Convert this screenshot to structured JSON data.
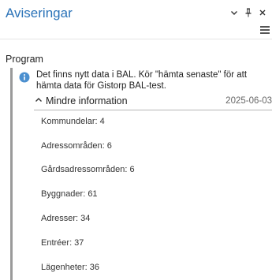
{
  "header": {
    "title": "Aviseringar"
  },
  "icons": {
    "options": "chevron-down-icon",
    "pin": "pin-icon",
    "close": "close-icon",
    "menu": "hamburger-menu-icon",
    "info": "info-icon",
    "toggle": "chevron-up-icon"
  },
  "colors": {
    "title": "#2b73b8",
    "info_icon": "#4b8fcf",
    "message_bar": "#9a9a9a"
  },
  "section": {
    "heading": "Program"
  },
  "notification": {
    "text": "Det finns nytt data i BAL. Kör \"hämta senaste\" för att hämta data för Gistorp BAL-test.",
    "toggle_label": "Mindre information",
    "date": "2025-06-03",
    "details": [
      "Kommundelar: 4",
      "Adressområden: 6",
      "Gårdsadressområden: 6",
      "Byggnader: 61",
      "Adresser: 34",
      "Entréer: 37",
      "Lägenheter: 36"
    ]
  }
}
